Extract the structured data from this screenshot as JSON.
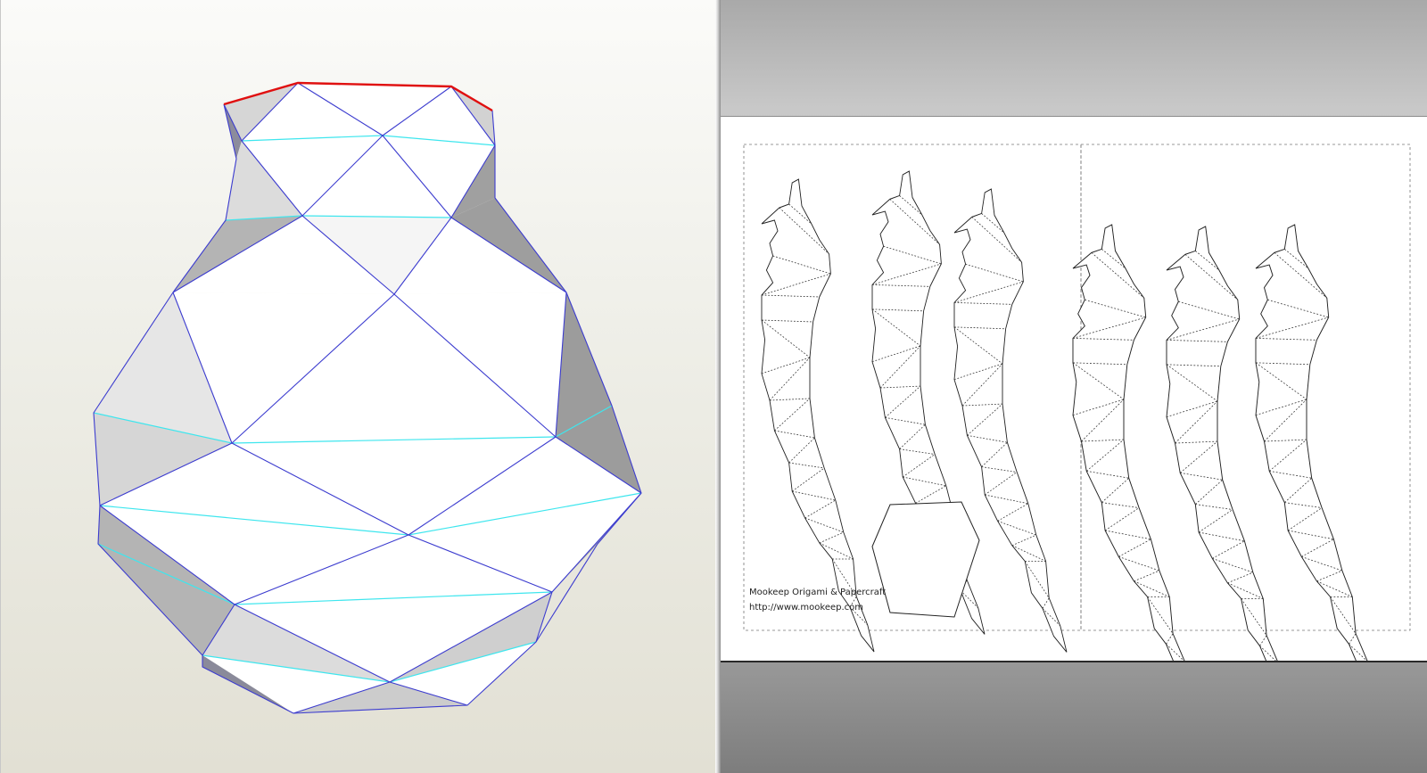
{
  "app": {
    "viewer_3d": "3D model view",
    "viewer_2d": "2D pattern view"
  },
  "pattern_sheet": {
    "credit_title": "Mookeep Origami & Papercraft",
    "credit_url": "http://www.mookeep.com"
  },
  "colors": {
    "edge_blue": "#3c3ccf",
    "seam_cyan": "#3ee6ee",
    "open_edge_red": "#e01010",
    "shade_gray": "#a8a8a8"
  }
}
